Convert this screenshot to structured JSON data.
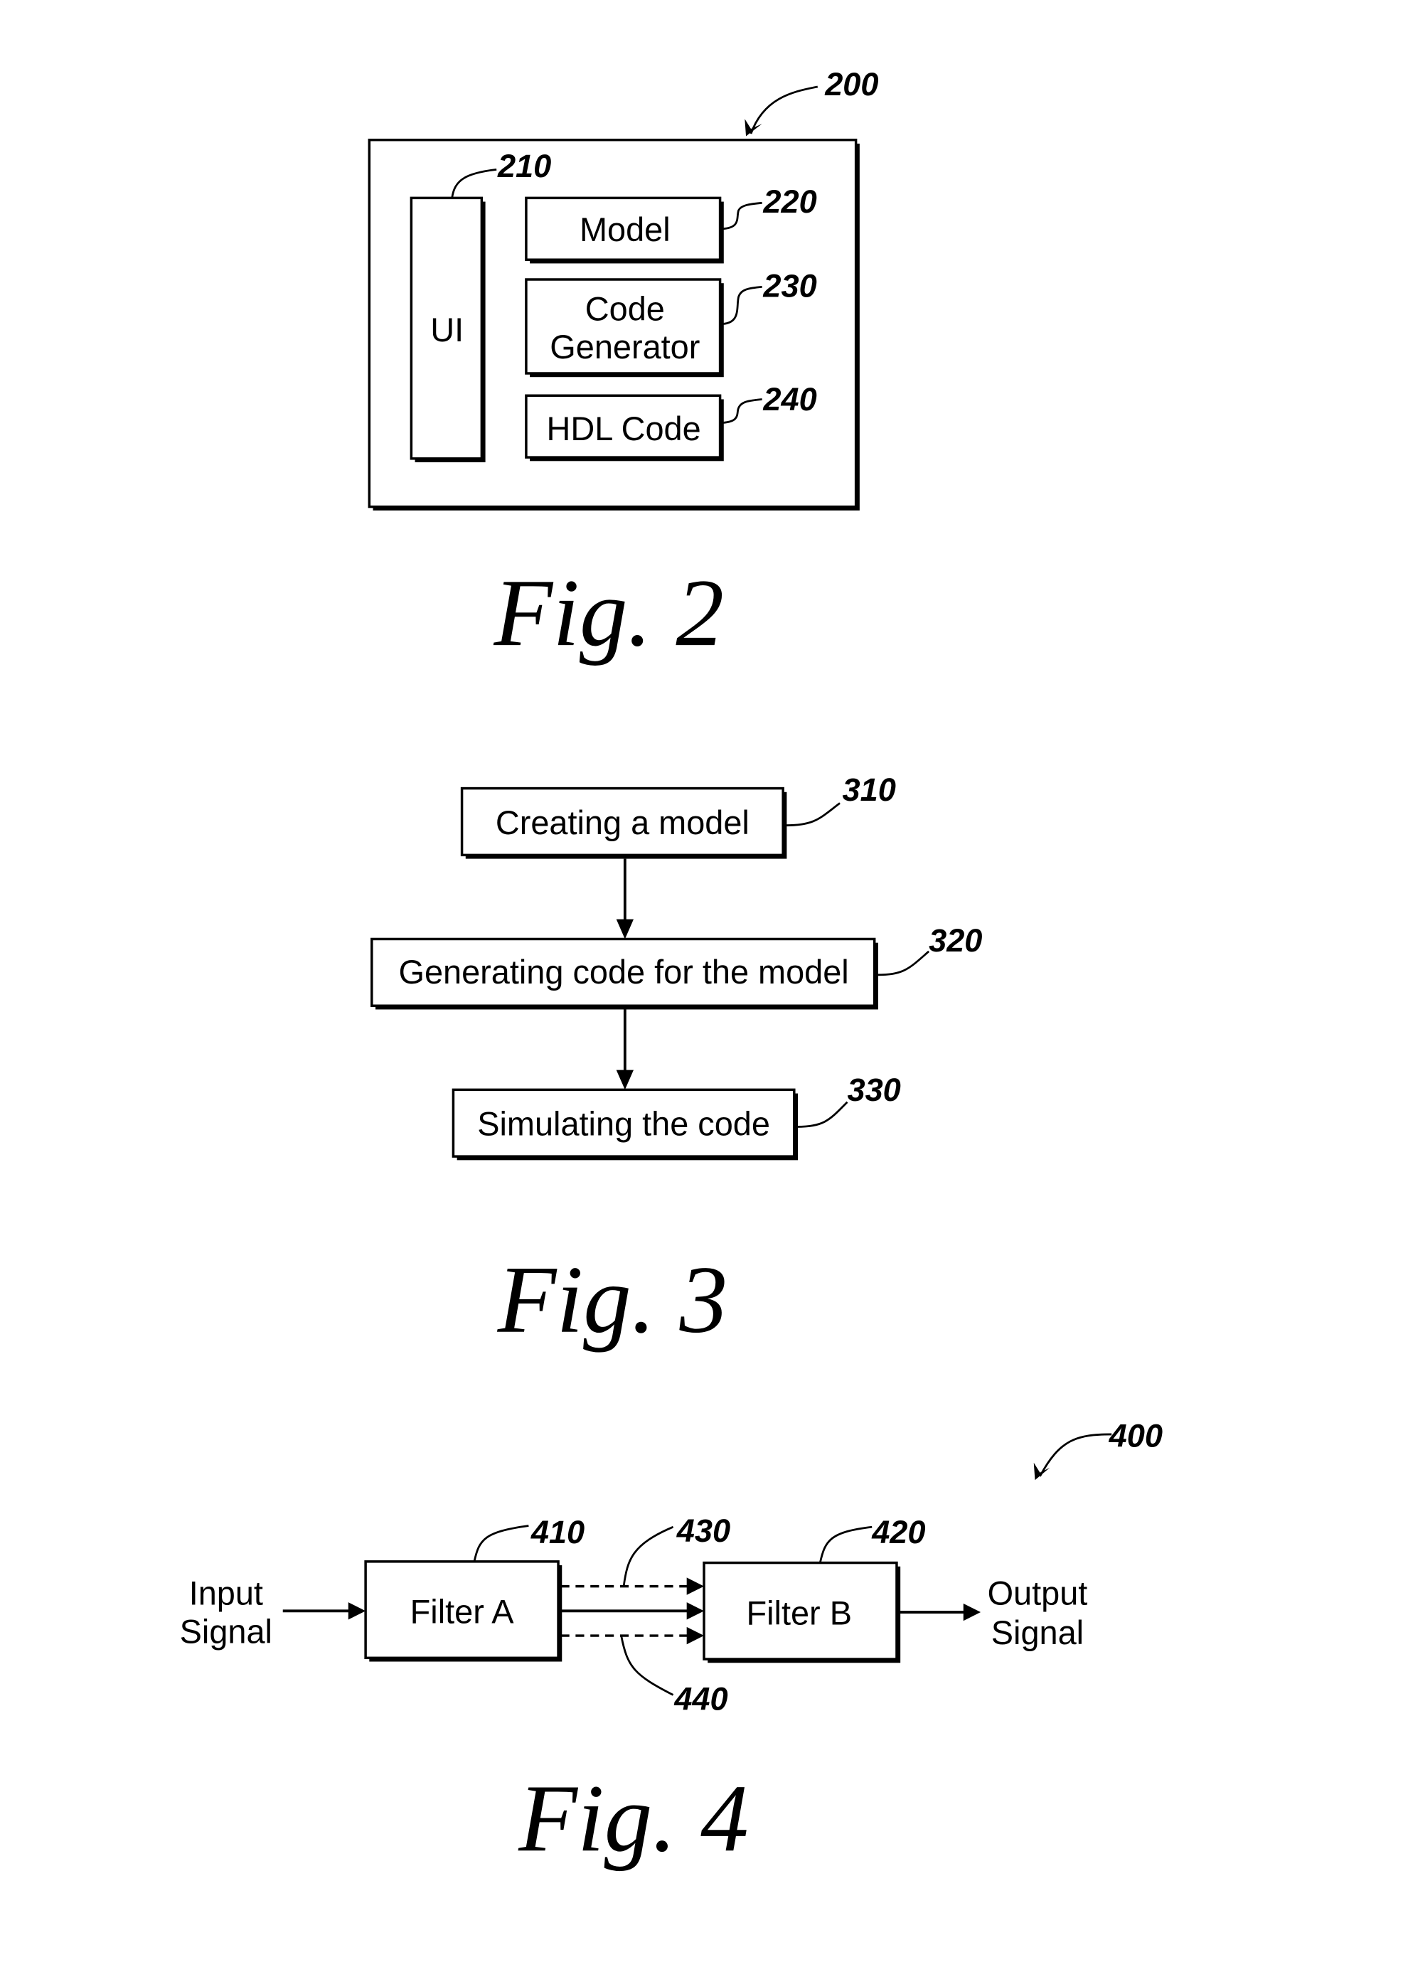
{
  "fig2": {
    "ref_system": "200",
    "caption": "Fig. 2",
    "blocks": [
      {
        "ref": "210",
        "label": "UI"
      },
      {
        "ref": "220",
        "label": "Model"
      },
      {
        "ref": "230",
        "label_line1": "Code",
        "label_line2": "Generator"
      },
      {
        "ref": "240",
        "label": "HDL Code"
      }
    ]
  },
  "fig3": {
    "caption": "Fig. 3",
    "steps": [
      {
        "ref": "310",
        "label": "Creating a model"
      },
      {
        "ref": "320",
        "label": "Generating code for the model"
      },
      {
        "ref": "330",
        "label": "Simulating the code"
      }
    ]
  },
  "fig4": {
    "ref_system": "400",
    "caption": "Fig. 4",
    "input_label_line1": "Input",
    "input_label_line2": "Signal",
    "output_label_line1": "Output",
    "output_label_line2": "Signal",
    "filter_a": {
      "ref": "410",
      "label": "Filter A"
    },
    "filter_b": {
      "ref": "420",
      "label": "Filter B"
    },
    "upper_link_ref": "430",
    "lower_link_ref": "440"
  }
}
